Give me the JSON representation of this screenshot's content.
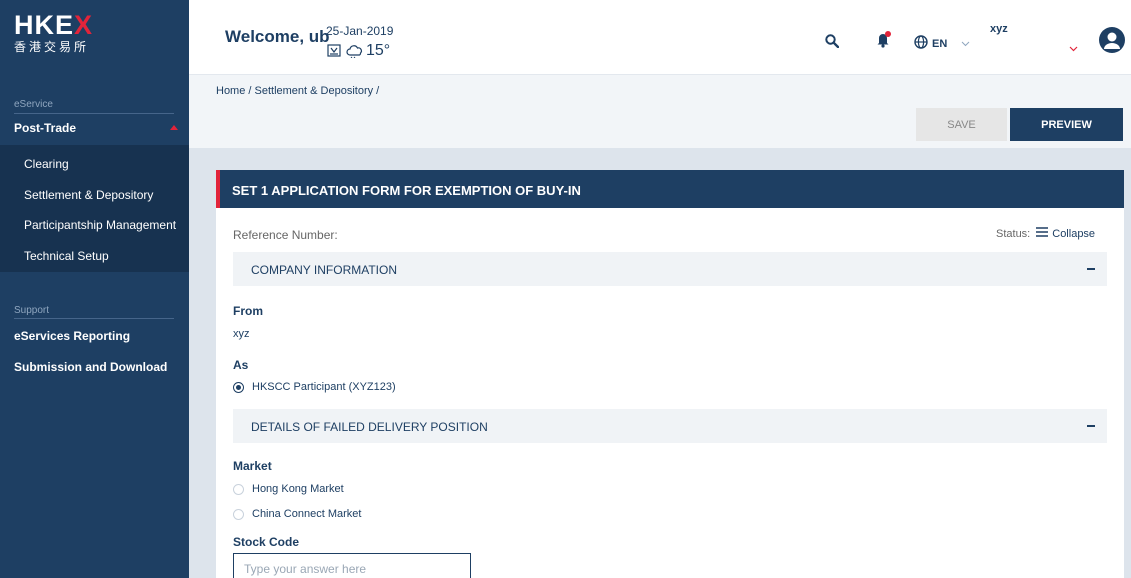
{
  "brand": {
    "logo_text": "HKEX",
    "logo_chinese": "香港交易所"
  },
  "sidebar": {
    "section1_label": "eService",
    "post_trade_label": "Post-Trade",
    "post_trade_items": [
      {
        "label": "Clearing"
      },
      {
        "label": "Settlement & Depository"
      },
      {
        "label": "Participantship Management"
      },
      {
        "label": "Technical Setup"
      }
    ],
    "section2_label": "Support",
    "support_items": [
      {
        "label": "eServices Reporting"
      },
      {
        "label": "Submission and Download"
      }
    ]
  },
  "header": {
    "welcome": "Welcome, ub",
    "date": "25-Jan-2019",
    "temperature": "15°",
    "language": "EN",
    "user_name": "xyz"
  },
  "breadcrumb": "Home / Settlement & Depository /",
  "toolbar": {
    "save_label": "SAVE",
    "preview_label": "PREVIEW"
  },
  "form": {
    "title": "SET 1 APPLICATION FORM FOR EXEMPTION OF BUY-IN",
    "reference_label": "Reference Number:",
    "status_label": "Status:",
    "collapse_label": "Collapse",
    "company_section": "COMPANY INFORMATION",
    "from_label": "From",
    "from_value": "xyz",
    "as_label": "As",
    "as_option": "HKSCC Participant (XYZ123)",
    "failed_section": "DETAILS OF FAILED DELIVERY POSITION",
    "market_label": "Market",
    "market_options": [
      {
        "label": "Hong Kong Market",
        "selected": false
      },
      {
        "label": "China Connect Market",
        "selected": false
      }
    ],
    "stock_code_label": "Stock Code",
    "stock_code_placeholder": "Type your answer here"
  },
  "colors": {
    "navy": "#1e3f63",
    "accent_red": "#e2243a",
    "panel_bg": "#dde4ec"
  },
  "icons": [
    "search-icon",
    "bell-icon",
    "globe-icon",
    "chevron-down-icon",
    "user-avatar-icon",
    "weather-icon",
    "cloud-icon",
    "hamburger-icon",
    "minus-icon"
  ]
}
